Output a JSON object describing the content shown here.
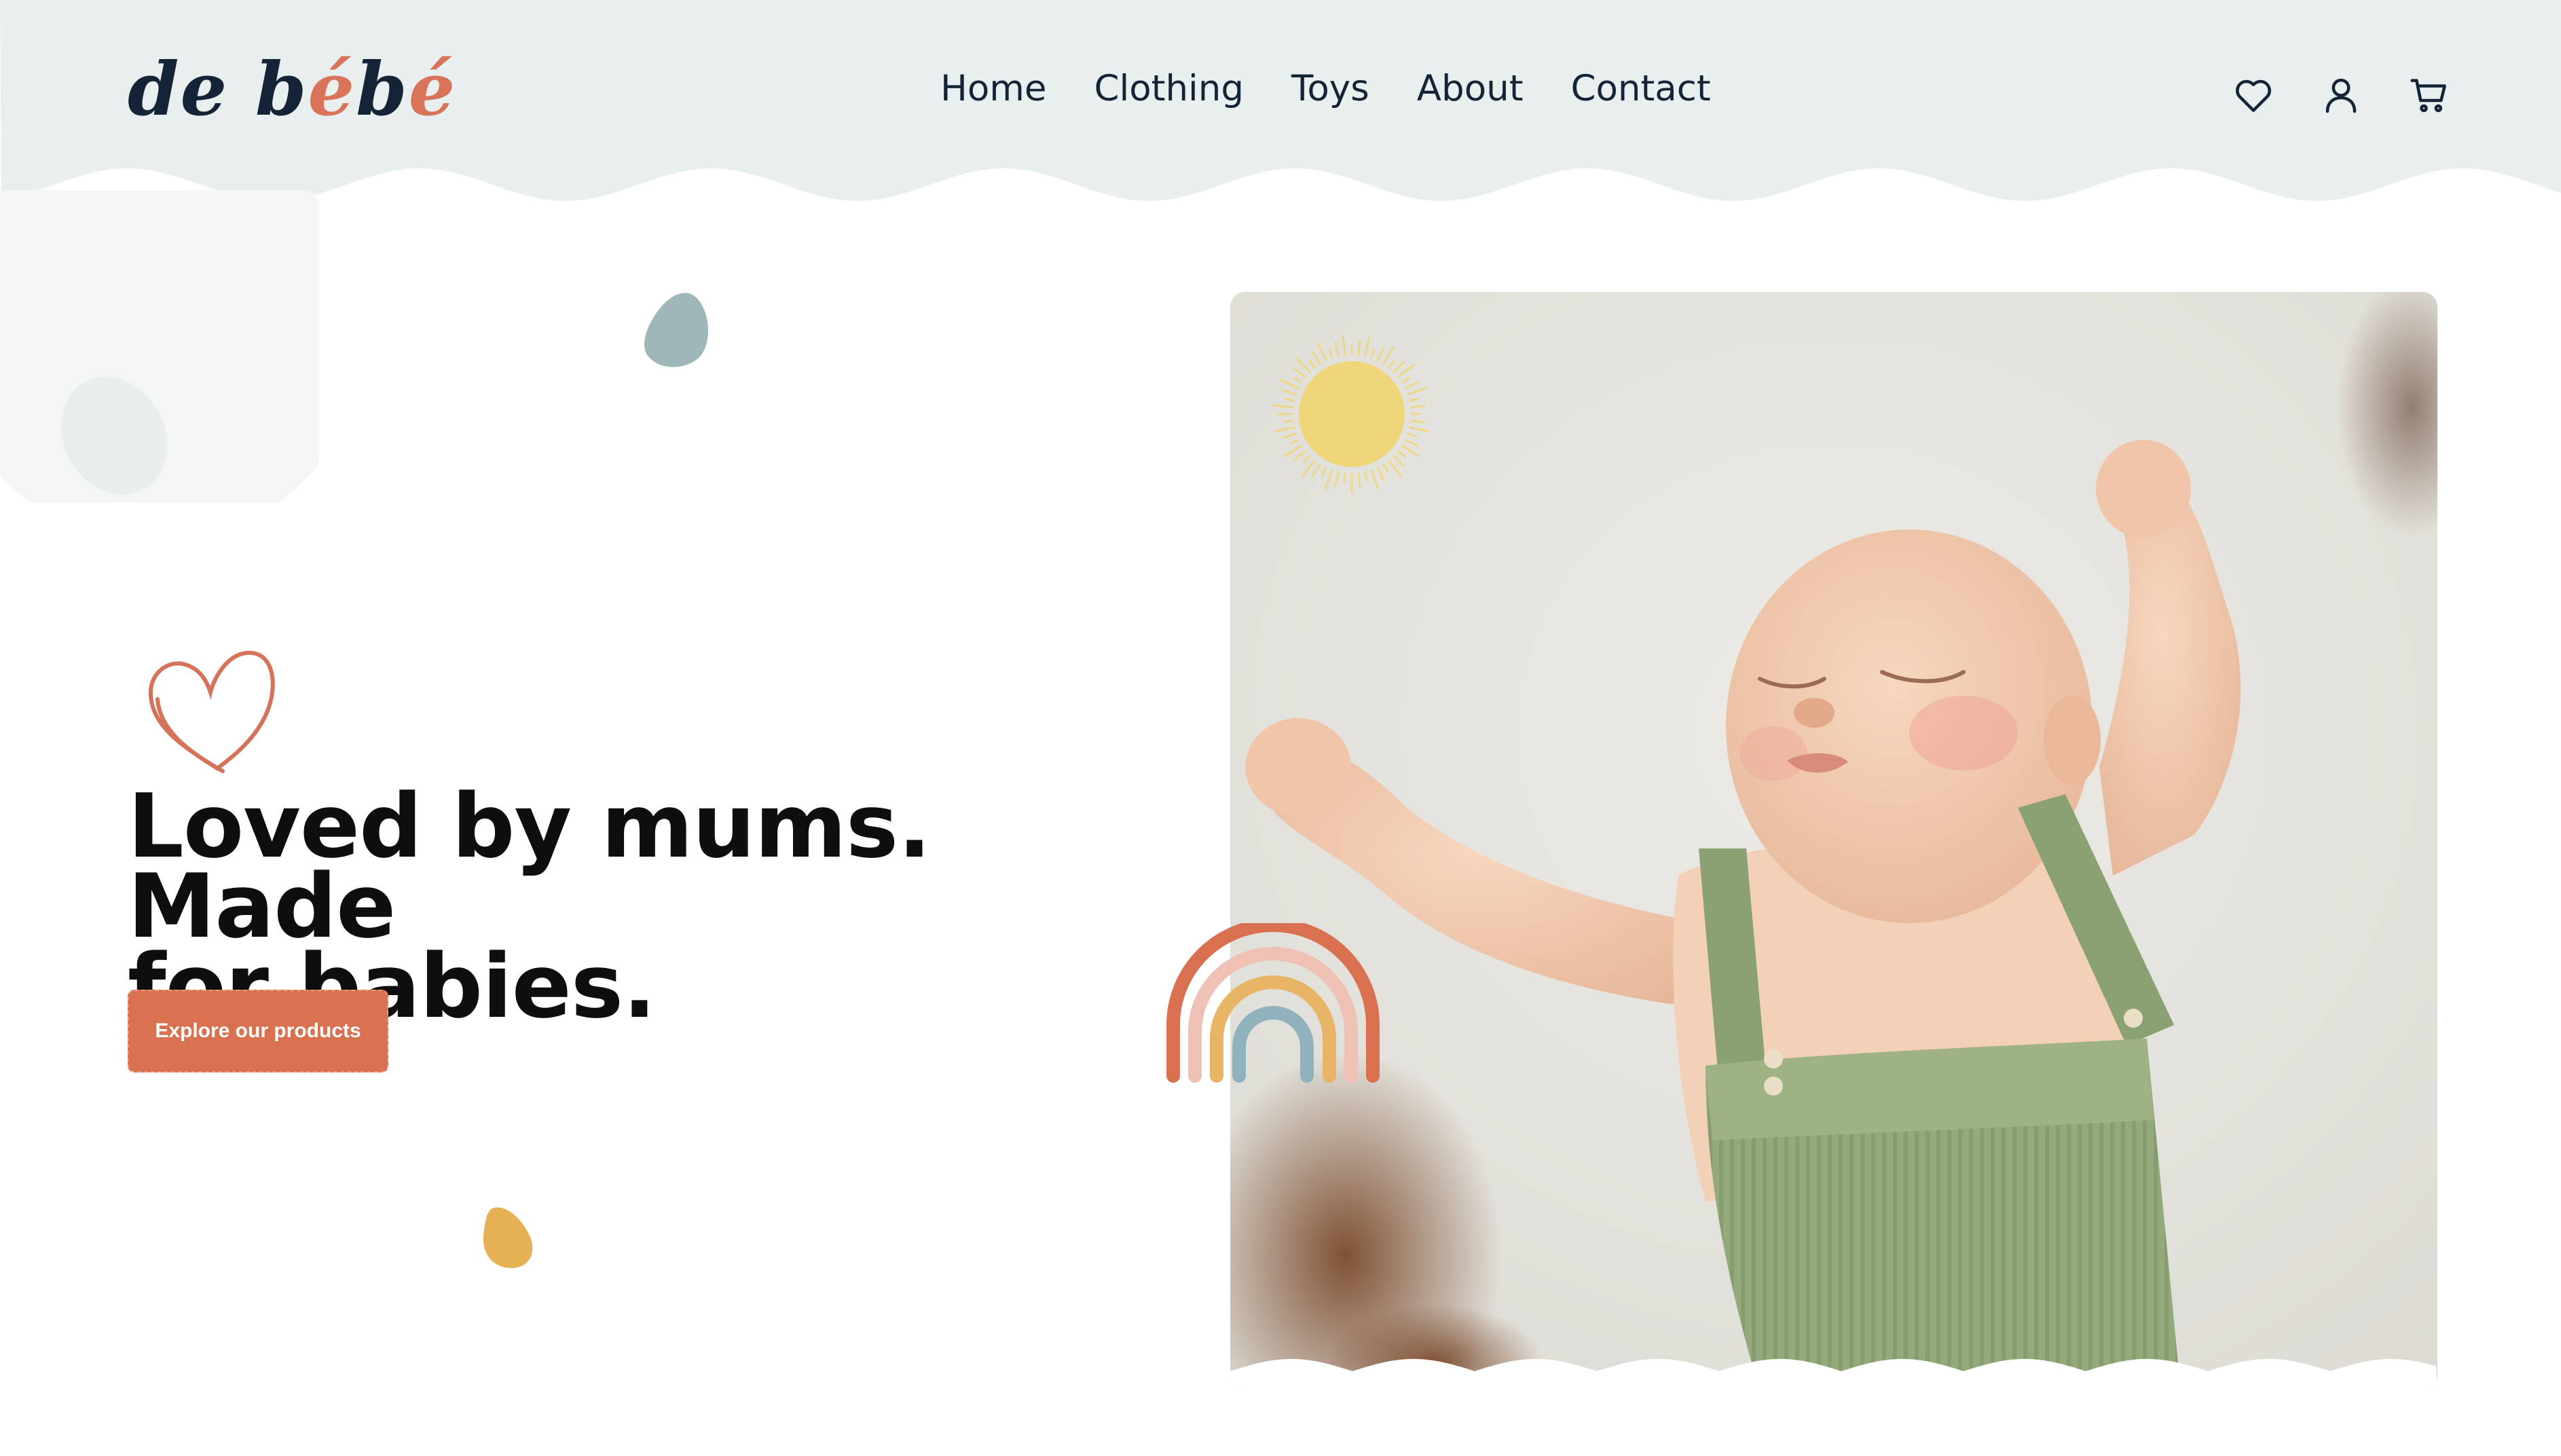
{
  "brand": {
    "name_part1": "de b",
    "name_accent": "é",
    "name_part2": "b",
    "name_accent2": "é"
  },
  "nav": {
    "items": [
      "Home",
      "Clothing",
      "Toys",
      "About",
      "Contact"
    ]
  },
  "header_icons": [
    "heart-icon",
    "user-icon",
    "cart-icon"
  ],
  "hero": {
    "headline_line1": "Loved by mums. Made",
    "headline_line2": "for babies.",
    "cta_label": "Explore our products"
  },
  "colors": {
    "header_bg": "#e9eeee",
    "accent": "#d9704f",
    "text_dark": "#142336",
    "sun": "#efd67a",
    "blob_teal": "#9fb7b8",
    "blob_mustard": "#e6b055",
    "knit_green": "#95aa7c"
  }
}
